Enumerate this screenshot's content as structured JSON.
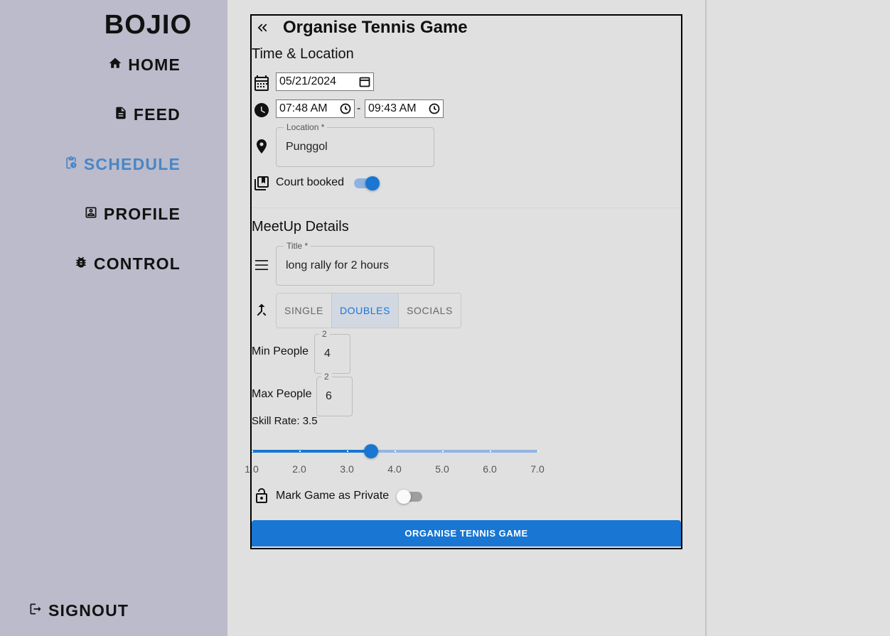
{
  "sidebar": {
    "logo": "BOJIO",
    "nav": [
      {
        "label": "HOME",
        "icon": "home-icon"
      },
      {
        "label": "FEED",
        "icon": "feed-icon"
      },
      {
        "label": "SCHEDULE",
        "icon": "schedule-icon",
        "active": true
      },
      {
        "label": "PROFILE",
        "icon": "profile-icon"
      },
      {
        "label": "CONTROL",
        "icon": "bug-icon"
      }
    ],
    "signout": "SIGNOUT"
  },
  "form": {
    "title": "Organise Tennis Game",
    "time_location": {
      "section_title": "Time & Location",
      "date": "05/21/2024",
      "start_time": "07:48 AM",
      "time_separator": "-",
      "end_time": "09:43 AM",
      "location_label": "Location *",
      "location_value": "Punggol",
      "court_booked_label": "Court booked",
      "court_booked": true
    },
    "meetup": {
      "section_title": "MeetUp Details",
      "title_label": "Title *",
      "title_value": "long rally for 2 hours",
      "game_types": [
        "SINGLE",
        "DOUBLES",
        "SOCIALS"
      ],
      "selected_game_type": "DOUBLES",
      "min_people_label": "Min People",
      "min_people_legend": "2",
      "min_people": "4",
      "max_people_label": "Max People",
      "max_people_legend": "2",
      "max_people": "6",
      "skill_label": "Skill Rate: 3.5",
      "skill_rate": 3.5,
      "skill_min": 1.0,
      "skill_max": 7.0,
      "skill_marks": [
        "1.0",
        "2.0",
        "3.0",
        "4.0",
        "5.0",
        "6.0",
        "7.0"
      ],
      "private_label": "Mark Game as Private",
      "private": false
    },
    "submit_label": "ORGANISE TENNIS GAME"
  },
  "colors": {
    "accent": "#1976d2",
    "nav_active": "#4a86c5",
    "sidebar_bg": "#bbbbcb",
    "page_bg": "#e0e0e0"
  }
}
